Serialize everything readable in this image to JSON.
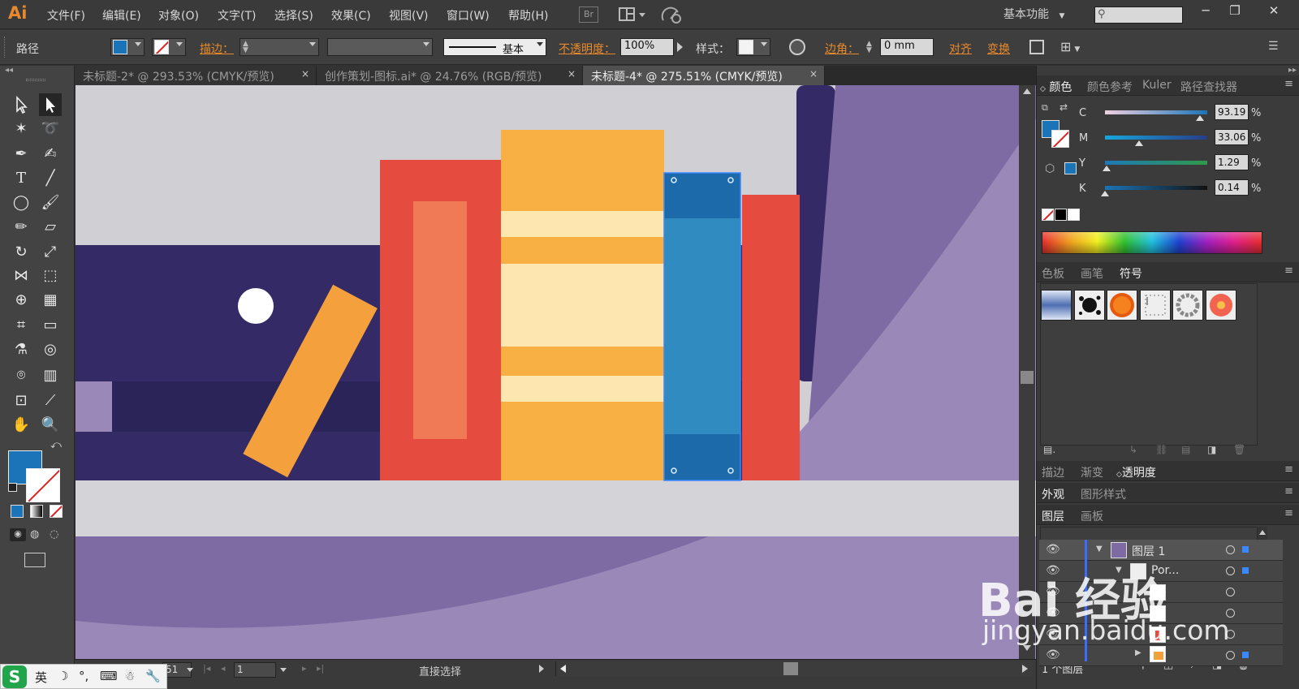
{
  "app": {
    "logo": "Ai"
  },
  "menu": [
    "文件(F)",
    "编辑(E)",
    "对象(O)",
    "文字(T)",
    "选择(S)",
    "效果(C)",
    "视图(V)",
    "窗口(W)",
    "帮助(H)"
  ],
  "menubar": {
    "bridge_label": "Br",
    "workspace": "基本功能",
    "search_icon": "magnifier-icon"
  },
  "window_buttons": [
    "minimize-icon",
    "restore-icon",
    "close-icon"
  ],
  "control_bar": {
    "object_type": "路径",
    "fill_color": "#1b74b8",
    "stroke_label": "描边：",
    "stroke_style": "基本",
    "opacity_label": "不透明度：",
    "opacity_value": "100%",
    "style_label": "样式：",
    "corner_label": "边角：",
    "corner_value": "0 mm",
    "align_label": "对齐",
    "transform_label": "变换"
  },
  "tabs": [
    {
      "label": "未标题-2* @ 293.53% (CMYK/预览)",
      "close": "×",
      "active": false
    },
    {
      "label": "创作策划-图标.ai* @ 24.76% (RGB/预览)",
      "close": "×",
      "active": false
    },
    {
      "label": "未标题-4* @ 275.51% (CMYK/预览)",
      "close": "×",
      "active": true
    }
  ],
  "tools": [
    "selection-tool-icon",
    "direct-selection-tool-icon",
    "magic-wand-icon",
    "lasso-icon",
    "pen-icon",
    "curvature-pen-icon",
    "type-tool-icon",
    "line-segment-icon",
    "ellipse-tool-icon",
    "paintbrush-icon",
    "pencil-icon",
    "eraser-icon",
    "rotate-icon",
    "scale-icon",
    "width-tool-icon",
    "free-transform-icon",
    "shape-builder-icon",
    "perspective-grid-icon",
    "mesh-icon",
    "gradient-icon",
    "eyedropper-icon",
    "blend-icon",
    "symbol-sprayer-icon",
    "column-graph-icon",
    "artboard-icon",
    "slice-icon",
    "hand-icon",
    "zoom-icon"
  ],
  "artwork_colors": {
    "wall": "#cfcfd4",
    "navy": "#332a66",
    "navy_dark": "#2b2458",
    "purple": "#7f6ba3",
    "purple_light": "#9a89b8",
    "shelf": "#d4d3d7",
    "red": "#e64b40",
    "coral": "#f07a56",
    "orange": "#f8b044",
    "cream": "#fde6b0",
    "tilted_book": "#f4a03c",
    "blue": "#2f8bc0",
    "blue_dark": "#1d6aaa",
    "white": "#ffffff"
  },
  "status_bar": {
    "zoom_suffix": "51",
    "artboard_number": "1",
    "current_tool": "直接选择"
  },
  "color_panel": {
    "tabs": [
      "颜色",
      "颜色参考",
      "Kuler",
      "路径查找器"
    ],
    "channels": [
      {
        "label": "C",
        "value": "93.19",
        "unit": "%",
        "level": 0.932
      },
      {
        "label": "M",
        "value": "33.06",
        "unit": "%",
        "level": 0.331
      },
      {
        "label": "Y",
        "value": "1.29",
        "unit": "%",
        "level": 0.013
      },
      {
        "label": "K",
        "value": "0.14",
        "unit": "%",
        "level": 0.001
      }
    ]
  },
  "swatch_panel": {
    "tabs": [
      "色板",
      "画笔",
      "符号"
    ]
  },
  "appearance_panel": {
    "tabs": [
      "描边",
      "渐变",
      "透明度"
    ]
  },
  "appearance_panel2": {
    "tabs": [
      "外观",
      "图形样式"
    ]
  },
  "layers_panel": {
    "tabs": [
      "图层",
      "画板"
    ],
    "layers": [
      "图层 1",
      "Por..."
    ],
    "footer": "1 个图层"
  },
  "ime": {
    "logo": "S",
    "lang": "英",
    "items": [
      "☽",
      "°,",
      "⌨",
      "☃",
      "🔧"
    ]
  },
  "watermark": {
    "logo": "Bai 经验",
    "url": "jingyan.baidu.com"
  }
}
